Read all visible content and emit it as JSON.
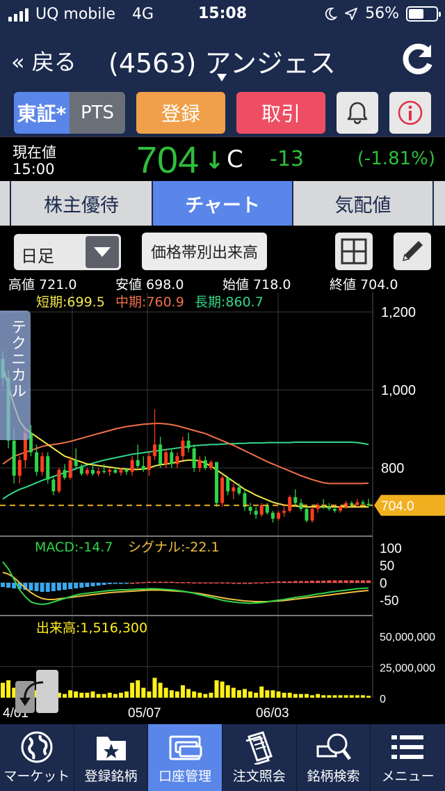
{
  "status": {
    "carrier": "UQ mobile",
    "network": "4G",
    "time": "15:08",
    "battery": "56%",
    "battery_level": 0.56
  },
  "nav": {
    "back": "« 戻る",
    "title": "(4563) アンジェス"
  },
  "toolbar": {
    "market": "東証*",
    "pts": "PTS",
    "register": "登録",
    "trade": "取引"
  },
  "quote": {
    "label_now": "現在値",
    "label_time": "15:00",
    "price": "704",
    "arrow": "↓",
    "flag": "C",
    "change": "-13",
    "change_pct": "(-1.81%)"
  },
  "tabs": [
    {
      "label": "株主優待",
      "active": false
    },
    {
      "label": "チャート",
      "active": true
    },
    {
      "label": "気配値",
      "active": false
    }
  ],
  "options": {
    "interval": "日足",
    "volume_profile": "価格帯別出来高"
  },
  "ohlc": {
    "high": "高値 721.0",
    "low": "安値 698.0",
    "open": "始値 718.0",
    "close": "終値 704.0"
  },
  "technical_tab": "テクニカル",
  "chart_data": {
    "type": "candlestick",
    "price_axis": {
      "ticks": [
        "1,200",
        "1,000",
        "800"
      ],
      "tick_values": [
        1200,
        1000,
        800
      ],
      "ylim": [
        625,
        1250
      ],
      "current": "704.0",
      "current_value": 704
    },
    "ma_legend": {
      "short": "短期:699.5",
      "mid": "中期:760.9",
      "long": "長期:860.7"
    },
    "date_ticks": [
      "4/01",
      "05/07",
      "06/03"
    ],
    "candles": [
      [
        1080,
        1100,
        1010,
        1030
      ],
      [
        1030,
        1050,
        850,
        870
      ],
      [
        870,
        900,
        760,
        780
      ],
      [
        780,
        830,
        760,
        820
      ],
      [
        820,
        900,
        800,
        890
      ],
      [
        890,
        910,
        830,
        840
      ],
      [
        840,
        860,
        780,
        790
      ],
      [
        790,
        840,
        780,
        830
      ],
      [
        830,
        840,
        760,
        770
      ],
      [
        770,
        780,
        730,
        740
      ],
      [
        740,
        800,
        735,
        795
      ],
      [
        795,
        810,
        770,
        775
      ],
      [
        775,
        830,
        770,
        820
      ],
      [
        820,
        850,
        800,
        805
      ],
      [
        805,
        810,
        780,
        785
      ],
      [
        785,
        800,
        780,
        795
      ],
      [
        795,
        810,
        780,
        785
      ],
      [
        785,
        800,
        778,
        792
      ],
      [
        792,
        810,
        785,
        790
      ],
      [
        790,
        800,
        780,
        795
      ],
      [
        795,
        800,
        785,
        788
      ],
      [
        788,
        800,
        780,
        795
      ],
      [
        795,
        800,
        782,
        790
      ],
      [
        790,
        830,
        780,
        820
      ],
      [
        820,
        860,
        800,
        805
      ],
      [
        805,
        830,
        790,
        795
      ],
      [
        795,
        840,
        780,
        830
      ],
      [
        830,
        950,
        820,
        860
      ],
      [
        860,
        880,
        800,
        810
      ],
      [
        810,
        850,
        800,
        840
      ],
      [
        840,
        850,
        800,
        810
      ],
      [
        810,
        840,
        800,
        830
      ],
      [
        830,
        880,
        820,
        870
      ],
      [
        870,
        890,
        840,
        850
      ],
      [
        850,
        860,
        790,
        800
      ],
      [
        800,
        830,
        790,
        820
      ],
      [
        820,
        830,
        795,
        800
      ],
      [
        800,
        820,
        795,
        815
      ],
      [
        815,
        810,
        700,
        710
      ],
      [
        710,
        780,
        700,
        775
      ],
      [
        775,
        770,
        730,
        740
      ],
      [
        740,
        760,
        720,
        750
      ],
      [
        750,
        760,
        730,
        735
      ],
      [
        735,
        745,
        690,
        700
      ],
      [
        700,
        710,
        680,
        690
      ],
      [
        690,
        700,
        670,
        680
      ],
      [
        680,
        710,
        675,
        705
      ],
      [
        705,
        710,
        680,
        685
      ],
      [
        685,
        690,
        660,
        670
      ],
      [
        670,
        690,
        665,
        685
      ],
      [
        685,
        700,
        675,
        690
      ],
      [
        690,
        730,
        685,
        725
      ],
      [
        725,
        745,
        700,
        710
      ],
      [
        710,
        720,
        690,
        695
      ],
      [
        695,
        700,
        660,
        665
      ],
      [
        665,
        700,
        660,
        695
      ],
      [
        695,
        710,
        685,
        705
      ],
      [
        705,
        720,
        695,
        700
      ],
      [
        700,
        710,
        690,
        695
      ],
      [
        695,
        700,
        685,
        690
      ],
      [
        690,
        705,
        685,
        700
      ],
      [
        700,
        715,
        695,
        710
      ],
      [
        710,
        715,
        700,
        705
      ],
      [
        705,
        720,
        700,
        712
      ],
      [
        712,
        718,
        705,
        708
      ],
      [
        708,
        721,
        698,
        704
      ]
    ],
    "ma_short": [
      1060,
      1010,
      960,
      920,
      900,
      890,
      880,
      870,
      860,
      850,
      840,
      830,
      825,
      820,
      815,
      810,
      808,
      806,
      804,
      802,
      800,
      798,
      797,
      796,
      796,
      797,
      800,
      805,
      808,
      810,
      812,
      815,
      818,
      820,
      820,
      818,
      812,
      805,
      795,
      785,
      775,
      765,
      755,
      745,
      738,
      730,
      724,
      718,
      712,
      708,
      705,
      703,
      702,
      701,
      700,
      700,
      700,
      700,
      700,
      700,
      700,
      700,
      700,
      700,
      700,
      700
    ],
    "ma_mid": [
      810,
      820,
      830,
      835,
      840,
      845,
      850,
      855,
      858,
      860,
      862,
      865,
      868,
      872,
      876,
      880,
      884,
      888,
      892,
      896,
      900,
      903,
      906,
      908,
      910,
      912,
      913,
      914,
      914,
      913,
      911,
      908,
      904,
      900,
      896,
      892,
      888,
      882,
      876,
      870,
      864,
      858,
      851,
      844,
      837,
      830,
      823,
      816,
      810,
      804,
      798,
      792,
      786,
      780,
      775,
      770,
      766,
      762,
      760,
      760,
      760,
      760,
      760,
      760,
      760,
      761
    ],
    "ma_long": [
      720,
      730,
      738,
      745,
      750,
      756,
      762,
      768,
      773,
      778,
      783,
      788,
      793,
      798,
      803,
      808,
      812,
      816,
      820,
      823,
      826,
      829,
      832,
      835,
      837,
      839,
      841,
      843,
      845,
      847,
      849,
      851,
      853,
      855,
      857,
      858,
      859,
      860,
      860,
      861,
      862,
      862,
      863,
      863,
      864,
      864,
      864,
      865,
      865,
      865,
      865,
      865,
      866,
      866,
      866,
      866,
      866,
      866,
      866,
      866,
      866,
      866,
      866,
      865,
      863,
      860
    ],
    "macd": {
      "label_macd": "MACD:-14.7",
      "label_signal": "シグナル:-22.1",
      "axis_ticks": [
        "100",
        "50",
        "0",
        "-50"
      ],
      "axis_values": [
        100,
        50,
        0,
        -50
      ],
      "ylim": [
        -90,
        130
      ],
      "macd": [
        60,
        40,
        10,
        -20,
        -40,
        -55,
        -60,
        -62,
        -60,
        -55,
        -50,
        -45,
        -40,
        -35,
        -32,
        -30,
        -28,
        -26,
        -24,
        -22,
        -21,
        -20,
        -20,
        -19,
        -18,
        -18,
        -17,
        -17,
        -18,
        -19,
        -20,
        -22,
        -24,
        -27,
        -30,
        -34,
        -38,
        -42,
        -46,
        -50,
        -53,
        -55,
        -57,
        -58,
        -59,
        -58,
        -57,
        -55,
        -52,
        -50,
        -48,
        -45,
        -42,
        -40,
        -38,
        -35,
        -32,
        -30,
        -27,
        -25,
        -23,
        -21,
        -19,
        -17,
        -16,
        -14.7
      ],
      "signal": [
        30,
        25,
        15,
        0,
        -15,
        -28,
        -38,
        -45,
        -48,
        -48,
        -46,
        -44,
        -42,
        -40,
        -38,
        -36,
        -34,
        -32,
        -30,
        -28,
        -27,
        -26,
        -25,
        -24,
        -23,
        -22,
        -21,
        -21,
        -21,
        -22,
        -23,
        -24,
        -25,
        -27,
        -29,
        -31,
        -34,
        -37,
        -40,
        -43,
        -46,
        -48,
        -50,
        -52,
        -53,
        -54,
        -54,
        -54,
        -53,
        -52,
        -51,
        -49,
        -47,
        -45,
        -43,
        -41,
        -39,
        -37,
        -35,
        -33,
        -31,
        -29,
        -27,
        -25,
        -23.5,
        -22.1
      ],
      "histogram": [
        -12,
        -14,
        -16,
        -18,
        -20,
        -22,
        -24,
        -26,
        -26,
        -24,
        -22,
        -20,
        -18,
        -16,
        -14,
        -12,
        -10,
        -8,
        -6,
        -4,
        -3,
        -2,
        -1,
        0,
        1,
        2,
        3,
        3,
        3,
        3,
        3,
        2,
        2,
        2,
        1,
        1,
        1,
        1,
        1,
        1,
        1,
        0,
        0,
        0,
        0,
        1,
        1,
        2,
        3,
        4,
        4,
        4,
        5,
        5,
        5,
        6,
        6,
        6,
        7,
        7,
        7,
        7,
        7,
        7,
        7,
        7
      ]
    },
    "volume": {
      "label": "出来高:1,516,300",
      "axis_ticks": [
        "50,000,000",
        "25,000,000",
        "0"
      ],
      "axis_values": [
        50000000,
        25000000,
        0
      ],
      "ylim": [
        0,
        65000000
      ],
      "values": [
        12000000,
        14000000,
        8000000,
        5000000,
        3000000,
        5000000,
        6000000,
        4000000,
        7000000,
        3000000,
        4000000,
        3000000,
        6000000,
        5000000,
        4000000,
        4000000,
        5000000,
        3000000,
        3000000,
        4000000,
        3000000,
        4000000,
        5000000,
        12000000,
        14000000,
        8000000,
        5000000,
        16000000,
        12000000,
        8000000,
        6000000,
        5000000,
        10000000,
        7000000,
        5000000,
        4000000,
        3000000,
        4000000,
        14000000,
        13000000,
        10000000,
        8000000,
        6000000,
        7000000,
        5000000,
        4000000,
        9000000,
        6000000,
        6000000,
        5000000,
        4000000,
        4000000,
        3000000,
        3000000,
        3000000,
        2000000,
        3000000,
        2000000,
        2000000,
        2000000,
        2000000,
        2000000,
        2000000,
        2000000,
        2000000,
        1516300
      ]
    },
    "colors": {
      "up": "#ff3d1f",
      "down": "#2ed44a",
      "ma_short": "#f4e64a",
      "ma_mid": "#f07048",
      "ma_long": "#34d88a",
      "macd": "#2ed44a",
      "signal": "#f0c040",
      "hist_neg": "#3aa8f0",
      "hist_pos": "#ff4d4d",
      "volume": "#fff01a",
      "current": "#f0b020"
    }
  },
  "bottom_tabs": [
    {
      "label": "マーケット",
      "icon": "globe-icon",
      "active": false
    },
    {
      "label": "登録銘柄",
      "icon": "folder-star-icon",
      "active": false
    },
    {
      "label": "口座管理",
      "icon": "wallet-icon",
      "active": true
    },
    {
      "label": "注文照会",
      "icon": "document-icon",
      "active": false
    },
    {
      "label": "銘柄検索",
      "icon": "magnifier-icon",
      "active": false
    },
    {
      "label": "メニュー",
      "icon": "menu-list-icon",
      "active": false
    }
  ]
}
